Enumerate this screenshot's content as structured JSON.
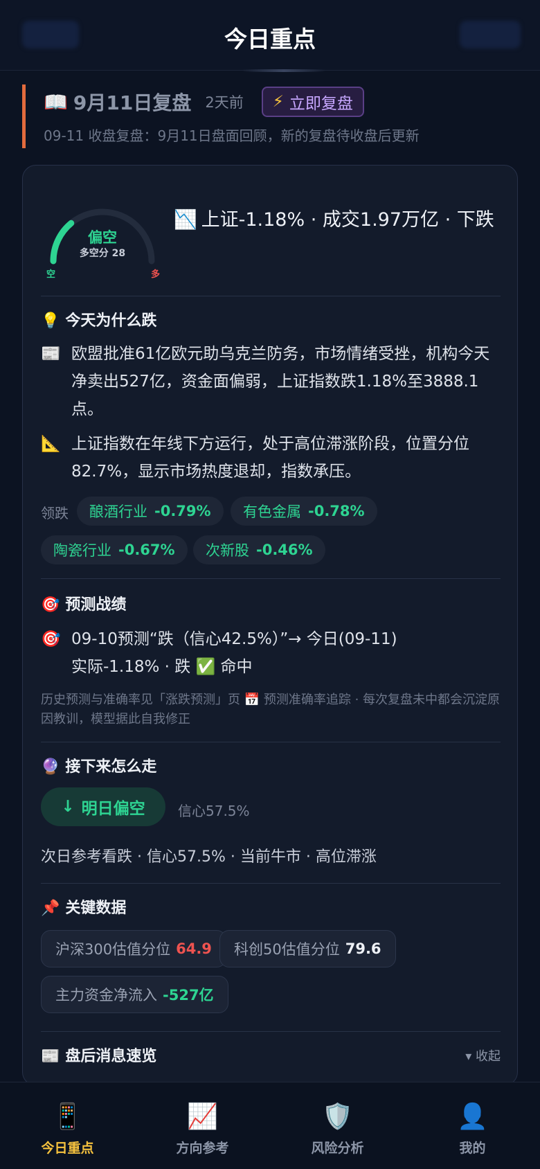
{
  "header": {
    "title": "今日重点"
  },
  "review": {
    "icon": "open-book-icon",
    "book_glyph": "📖",
    "title": "9月11日复盘",
    "ago": "2天前",
    "button_icon": "⚡",
    "button_label": "立即复盘",
    "subtitle": "09-11 收盘复盘：9月11日盘面回顾，新的复盘待收盘后更新"
  },
  "gauge": {
    "label": "偏空",
    "score_text": "多空分 28",
    "score": 28,
    "left_label": "空",
    "right_label": "多"
  },
  "headline": {
    "emoji": "📉",
    "text": "上证-1.18% · 成交1.97万亿 · 下跌"
  },
  "why": {
    "icon": "💡",
    "title": "今天为什么跌",
    "items": [
      {
        "icon": "📰",
        "text": "欧盟批准61亿欧元助乌克兰防务，市场情绪受挫，机构今天净卖出527亿，资金面偏弱，上证指数跌1.18%至3888.1点。"
      },
      {
        "icon": "📐",
        "text": "上证指数在年线下方运行，处于高位滞涨阶段，位置分位82.7%，显示市场热度退却，指数承压。"
      }
    ],
    "lead_label": "领跌",
    "sectors": [
      {
        "name": "酿酒行业",
        "value": "-0.79%"
      },
      {
        "name": "有色金属",
        "value": "-0.78%"
      },
      {
        "name": "陶瓷行业",
        "value": "-0.67%"
      },
      {
        "name": "次新股",
        "value": "-0.46%"
      }
    ]
  },
  "record": {
    "icon": "🎯",
    "title": "预测战绩",
    "line_icon": "🎯",
    "line": "09-10预测“跌（信心42.5%）”→ 今日(09-11)实际-1.18% · 跌 ✅ 命中",
    "note": "历史预测与准确率见「涨跌预测」页 📅 预测准确率追踪 · 每次复盘未中都会沉淀原因教训，模型据此自我修正"
  },
  "next": {
    "icon": "🔮",
    "title": "接下来怎么走",
    "pill_arrow": "↓",
    "pill_label": "明日偏空",
    "confidence": "信心57.5%",
    "summary": "次日参考看跌 · 信心57.5% · 当前牛市 · 高位滞涨"
  },
  "key": {
    "icon": "📌",
    "title": "关键数据",
    "items": [
      {
        "label": "沪深300估值分位",
        "value": "64.9",
        "color": "#ef5350"
      },
      {
        "label": "科创50估值分位",
        "value": "79.6",
        "color": "#eef1f6"
      },
      {
        "label": "主力资金净流入",
        "value": "-527亿",
        "color": "#2ed492"
      }
    ]
  },
  "news": {
    "icon": "📰",
    "title": "盘后消息速览",
    "collapse": "▾ 收起"
  },
  "nav": [
    {
      "icon": "📱",
      "label": "今日重点",
      "active": true
    },
    {
      "icon": "📈",
      "label": "方向参考",
      "active": false
    },
    {
      "icon": "🛡️",
      "label": "风险分析",
      "active": false
    },
    {
      "icon": "👤",
      "label": "我的",
      "active": false
    }
  ],
  "colors": {
    "down": "#2ed492",
    "up": "#ef5350",
    "accent": "#f6c23e",
    "bg": "#0c1322"
  }
}
